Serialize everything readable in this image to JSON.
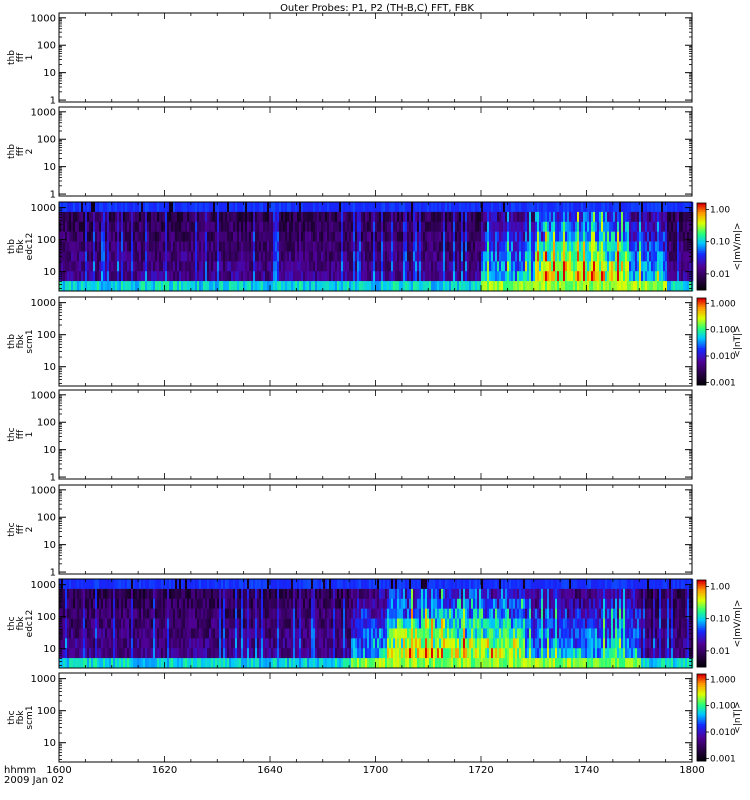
{
  "title": "Outer Probes: P1, P2 (TH-B,C) FFT, FBK",
  "x_axis": {
    "unit_label": "hhmm",
    "date_label": "2009 Jan 02",
    "ticks": [
      "1600",
      "1620",
      "1640",
      "1700",
      "1720",
      "1740",
      "1800"
    ],
    "range_minutes": [
      0,
      120
    ]
  },
  "y_axis": {
    "scale": "log",
    "ticks_with_1": [
      "1",
      "10",
      "100",
      "1000"
    ],
    "ticks_no_1": [
      "10",
      "100",
      "1000"
    ]
  },
  "colorbars": {
    "edc": {
      "label": "<|mV/m|>",
      "ticks": [
        "1.00",
        "0.10",
        "0.01"
      ],
      "ticks_log": [
        0,
        -1,
        -2
      ],
      "log_range": [
        -2.5,
        0.2
      ]
    },
    "scm": {
      "label": "<|nT|>",
      "ticks": [
        "1.000",
        "0.100",
        "0.010",
        "0.001"
      ],
      "ticks_log": [
        0,
        -1,
        -2,
        -3
      ],
      "log_range": [
        -3.1,
        0.2
      ]
    }
  },
  "chart_data": [
    {
      "type": "heatmap",
      "panel_label": [
        "thb",
        "fff",
        "1"
      ],
      "empty": true,
      "y_ticks": "with_1",
      "colorbar": null
    },
    {
      "type": "heatmap",
      "panel_label": [
        "thb",
        "fff",
        "2"
      ],
      "empty": true,
      "y_ticks": "with_1",
      "colorbar": null
    },
    {
      "type": "heatmap",
      "panel_label": [
        "thb",
        "fbk",
        "edc12"
      ],
      "empty": false,
      "y_ticks": "no_1",
      "colorbar": "edc",
      "probe_seed": 7,
      "burst_minutes": [
        80,
        115
      ],
      "burst_peak_minutes": [
        90,
        108
      ]
    },
    {
      "type": "heatmap",
      "panel_label": [
        "thb",
        "fbk",
        "scm1"
      ],
      "empty": true,
      "y_ticks": "no_1",
      "colorbar": "scm"
    },
    {
      "type": "heatmap",
      "panel_label": [
        "thc",
        "fff",
        "1"
      ],
      "empty": true,
      "y_ticks": "with_1",
      "colorbar": null
    },
    {
      "type": "heatmap",
      "panel_label": [
        "thc",
        "fff",
        "2"
      ],
      "empty": true,
      "y_ticks": "with_1",
      "colorbar": null
    },
    {
      "type": "heatmap",
      "panel_label": [
        "thc",
        "fbk",
        "edc12"
      ],
      "empty": false,
      "y_ticks": "no_1",
      "colorbar": "edc",
      "probe_seed": 19,
      "burst_minutes": [
        55,
        110
      ],
      "burst_peak_minutes": [
        62,
        88
      ]
    },
    {
      "type": "heatmap",
      "panel_label": [
        "thc",
        "fbk",
        "scm1"
      ],
      "empty": true,
      "y_ticks": "no_1",
      "colorbar": "scm"
    }
  ]
}
